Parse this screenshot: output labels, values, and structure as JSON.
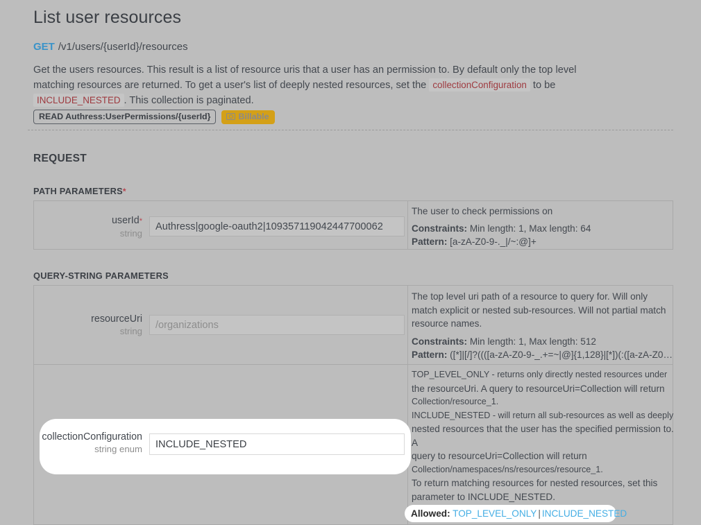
{
  "header": {
    "title": "List user resources",
    "method": "GET",
    "path": "/v1/users/{userId}/resources",
    "description_part1": "Get the users resources. This result is a list of resource uris that a user has an permission to. By default only the top level matching resources are returned. To get a user's list of deeply nested resources, set the ",
    "description_code1": "collectionConfiguration",
    "description_part2": " to be ",
    "description_code2": "INCLUDE_NESTED",
    "description_part3": ". This collection is paginated.",
    "badge_permission": "READ Authress:UserPermissions/{userId}",
    "badge_billable": "Billable",
    "badge_billable_icon": "billable-coin-icon"
  },
  "request": {
    "section_label": "REQUEST",
    "path_params_label": "PATH PARAMETERS",
    "path_params_required_marker": "*",
    "query_params_label": "QUERY-STRING PARAMETERS"
  },
  "path_parameters": [
    {
      "name": "userId",
      "required_marker": "*",
      "type": "string",
      "value": "Authress|google-oauth2|109357119042447700062",
      "placeholder": "",
      "description": "The user to check permissions on",
      "constraints_label": "Constraints:",
      "constraints_value": " Min length: 1, Max length: 64",
      "pattern_label": "Pattern:",
      "pattern_value": " [a-zA-Z0-9-._|/~:@]+"
    }
  ],
  "query_parameters": [
    {
      "name": "resourceUri",
      "type": "string",
      "value": "",
      "placeholder": "/organizations",
      "description": "The top level uri path of a resource to query for. Will only match explicit or nested sub-resources. Will not partial match resource names.",
      "constraints_label": "Constraints:",
      "constraints_value": " Min length: 1, Max length: 512",
      "pattern_label": "Pattern:",
      "pattern_value": " ([*]|[/]?((([a-zA-Z0-9-_.+=~|@]{1,128}|[*])(:([a-zA-Z0-9-_..."
    },
    {
      "name": "collectionConfiguration",
      "type": "string enum",
      "value": "INCLUDE_NESTED",
      "placeholder": "",
      "desc_lines": [
        "TOP_LEVEL_ONLY - returns only directly nested resources under",
        "the resourceUri. A query to resourceUri=Collection will return",
        "Collection/resource_1.",
        "INCLUDE_NESTED - will return all sub-resources as well as deeply",
        "nested resources that the user has the specified permission to. A",
        "query to resourceUri=Collection will return",
        "Collection/namespaces/ns/resources/resource_1."
      ],
      "desc_note_lines": [
        "To return matching resources for nested resources, set this",
        "parameter to INCLUDE_NESTED."
      ],
      "allowed_label": "Allowed:",
      "allowed_values": [
        "TOP_LEVEL_ONLY",
        "INCLUDE_NESTED"
      ],
      "allowed_separator": "|"
    }
  ],
  "colors": {
    "page_background": "#bdbdbd",
    "method_get": "#3a93c9",
    "inline_code_text": "#9e3a3f",
    "billable_badge": "#d4a017",
    "enum_link": "#45aee4",
    "required_star": "#b8434d",
    "spotlight": "#ffffff"
  }
}
